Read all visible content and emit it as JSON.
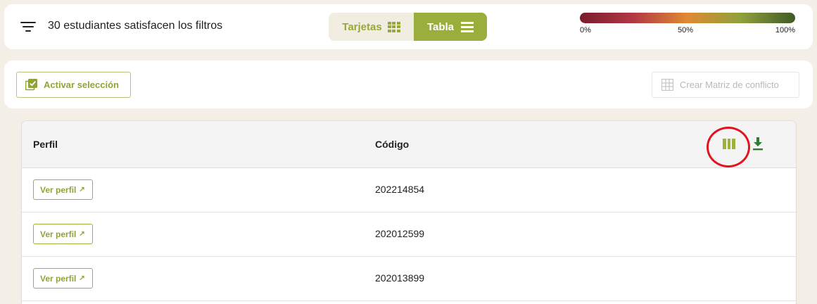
{
  "header": {
    "filter_icon": "filter-list-icon",
    "result_text": "30 estudiantes satisfacen los filtros",
    "view_toggle": {
      "cards_label": "Tarjetas",
      "cards_icon": "grid-icon",
      "table_label": "Tabla",
      "table_icon": "list-icon",
      "selected": "Tabla"
    },
    "gradient": {
      "colors": [
        "#7a1c2c",
        "#b33844",
        "#df8a33",
        "#8ea03c",
        "#3f5a26"
      ],
      "labels": [
        "0%",
        "50%",
        "100%"
      ]
    }
  },
  "actions": {
    "activate_label": "Activar selección",
    "activate_icon": "checkbox-stack-icon",
    "matrix_label": "Crear Matriz de conflicto",
    "matrix_icon": "grid-table-icon",
    "matrix_disabled": true
  },
  "table": {
    "columns": [
      "Perfil",
      "Código"
    ],
    "columns_icon": "view-columns-icon",
    "download_icon": "download-icon",
    "rows": [
      {
        "profile_label": "Ver perfil",
        "code": "202214854"
      },
      {
        "profile_label": "Ver perfil",
        "code": "202012599"
      },
      {
        "profile_label": "Ver perfil",
        "code": "202013899"
      }
    ]
  },
  "colors": {
    "accent": "#99ae3c",
    "background": "#f3efe6",
    "highlight": "#e1141f"
  }
}
